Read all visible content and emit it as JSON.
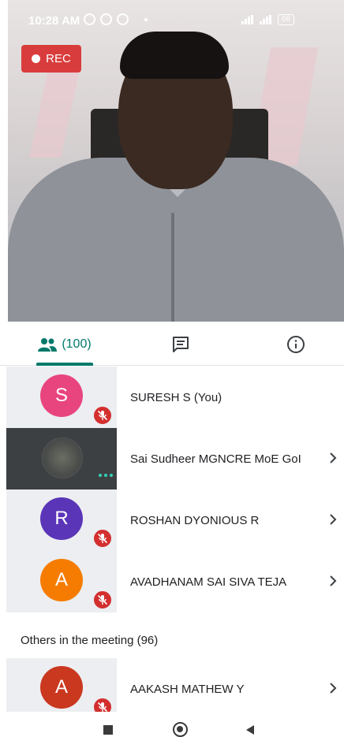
{
  "status_bar": {
    "time": "10:28 AM",
    "battery": "66"
  },
  "recording": {
    "label": "REC"
  },
  "tabs": {
    "people_count": "(100)"
  },
  "participants": [
    {
      "initial": "S",
      "name": "SURESH S (You)",
      "avatar_color": "#e8457f",
      "muted": true
    },
    {
      "initial": "",
      "name": "Sai Sudheer MGNCRE MoE GoI",
      "video": true
    },
    {
      "initial": "R",
      "name": "ROSHAN DYONIOUS R",
      "avatar_color": "#5b35b8",
      "muted": true
    },
    {
      "initial": "A",
      "name": "AVADHANAM SAI SIVA TEJA",
      "avatar_color": "#f57c00",
      "muted": true
    }
  ],
  "others_section": {
    "title": "Others in the meeting (96)"
  },
  "others": [
    {
      "initial": "A",
      "name": "AAKASH MATHEW Y",
      "avatar_color": "#c9381f",
      "muted": true
    }
  ],
  "colors": {
    "accent": "#00796b",
    "rec": "#d93c3c",
    "mute": "#d32f2f"
  }
}
